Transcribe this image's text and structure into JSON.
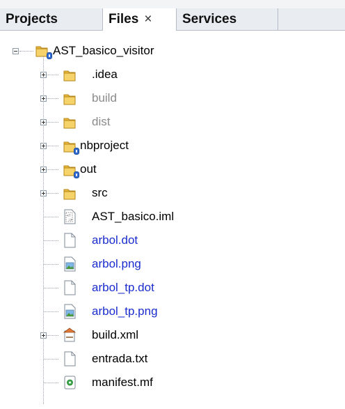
{
  "tabs": [
    {
      "label": "Projects",
      "active": false
    },
    {
      "label": "Files",
      "close_glyph": "×",
      "active": true
    },
    {
      "label": "Services",
      "active": false
    }
  ],
  "tree": {
    "root": {
      "label": "AST_basico_visitor",
      "icon": "project-folder-icon",
      "expanded": true
    },
    "items": [
      {
        "label": ".idea",
        "icon": "folder-icon",
        "expandable": true,
        "color": "#000000"
      },
      {
        "label": "build",
        "icon": "folder-icon",
        "expandable": true,
        "color": "#8a8a8a"
      },
      {
        "label": "dist",
        "icon": "folder-icon",
        "expandable": true,
        "color": "#8a8a8a"
      },
      {
        "label": "nbproject",
        "icon": "folder-versioned-icon",
        "expandable": true,
        "color": "#000000"
      },
      {
        "label": "out",
        "icon": "folder-versioned-icon",
        "expandable": true,
        "color": "#000000"
      },
      {
        "label": "src",
        "icon": "folder-icon",
        "expandable": true,
        "color": "#000000"
      },
      {
        "label": "AST_basico.iml",
        "icon": "xml-file-icon",
        "expandable": false,
        "color": "#000000"
      },
      {
        "label": "arbol.dot",
        "icon": "file-icon",
        "expandable": false,
        "color": "#1a2ccf"
      },
      {
        "label": "arbol.png",
        "icon": "image-file-icon",
        "expandable": false,
        "color": "#1a2ccf"
      },
      {
        "label": "arbol_tp.dot",
        "icon": "file-icon",
        "expandable": false,
        "color": "#1a2ccf"
      },
      {
        "label": "arbol_tp.png",
        "icon": "image-file-icon",
        "expandable": false,
        "color": "#1a2ccf"
      },
      {
        "label": "build.xml",
        "icon": "ant-build-icon",
        "expandable": true,
        "color": "#000000"
      },
      {
        "label": "entrada.txt",
        "icon": "file-icon",
        "expandable": false,
        "color": "#000000"
      },
      {
        "label": "manifest.mf",
        "icon": "manifest-file-icon",
        "expandable": false,
        "color": "#000000"
      }
    ]
  }
}
